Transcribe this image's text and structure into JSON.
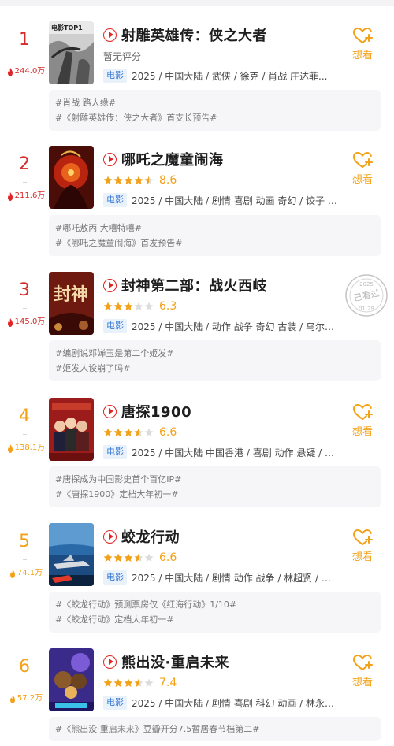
{
  "colors": {
    "rank_red": "#d52b2b",
    "rank_orange": "#f3a117",
    "accent_red": "#e12424",
    "score_orange": "#f3a117",
    "tag_blue": "#3a7bd5"
  },
  "want_label": "想看",
  "entries": [
    {
      "rank": "1",
      "heat": "244.0万",
      "title": "射雕英雄传：侠之大者",
      "no_score": "暂无评分",
      "rating": null,
      "stars": 0,
      "tag": "电影",
      "meta": "2025 / 中国大陆 / 武侠 / 徐克 / 肖战 庄达菲...",
      "poster_text": "电影TOP1",
      "hashtags": [
        "#肖战 路人缘#",
        "#《射雕英雄传：侠之大者》首支长预告#"
      ]
    },
    {
      "rank": "2",
      "heat": "211.6万",
      "title": "哪吒之魔童闹海",
      "no_score": "",
      "rating": "8.6",
      "stars": 4.5,
      "tag": "电影",
      "meta": "2025 / 中国大陆 / 剧情 喜剧 动画 奇幻 / 饺子 / ...",
      "poster_text": "",
      "hashtags": [
        "#哪吒敖丙 大嘻特嘻#",
        "#《哪吒之魔童闹海》首发预告#"
      ]
    },
    {
      "rank": "3",
      "heat": "145.0万",
      "title": "封神第二部：战火西岐",
      "no_score": "",
      "rating": "6.3",
      "stars": 3,
      "tag": "电影",
      "meta": "2025 / 中国大陆 / 动作 战争 奇幻 古装 / 乌尔善 ...",
      "poster_text": "封神",
      "hashtags": [
        "#编剧说邓婵玉是第二个姬发#",
        "#姬发人设崩了吗#"
      ]
    },
    {
      "rank": "4",
      "heat": "138.1万",
      "title": "唐探1900",
      "no_score": "",
      "rating": "6.6",
      "stars": 3.5,
      "tag": "电影",
      "meta": "2025 / 中国大陆 中国香港 / 喜剧 动作 悬疑 / 陈...",
      "poster_text": "",
      "hashtags": [
        "#唐探成为中国影史首个百亿IP#",
        "#《唐探1900》定档大年初一#"
      ]
    },
    {
      "rank": "5",
      "heat": "74.1万",
      "title": "蛟龙行动",
      "no_score": "",
      "rating": "6.6",
      "stars": 3.5,
      "tag": "电影",
      "meta": "2025 / 中国大陆 / 剧情 动作 战争 / 林超贤 / 黄...",
      "poster_text": "",
      "hashtags": [
        "#《蛟龙行动》预测票房仅《红海行动》1/10#",
        "#《蛟龙行动》定档大年初一#"
      ]
    },
    {
      "rank": "6",
      "heat": "57.2万",
      "title": "熊出没·重启未来",
      "no_score": "",
      "rating": "7.4",
      "stars": 3.5,
      "tag": "电影",
      "meta": "2025 / 中国大陆 / 剧情 喜剧 科幻 动画 / 林永长 ...",
      "poster_text": "",
      "hashtags": [
        "#《熊出没·重启未来》豆瓣开分7.5暂居春节档第二#"
      ]
    }
  ],
  "watched_stamp": {
    "year": "2025",
    "text": "已看过",
    "date": "01.29"
  }
}
